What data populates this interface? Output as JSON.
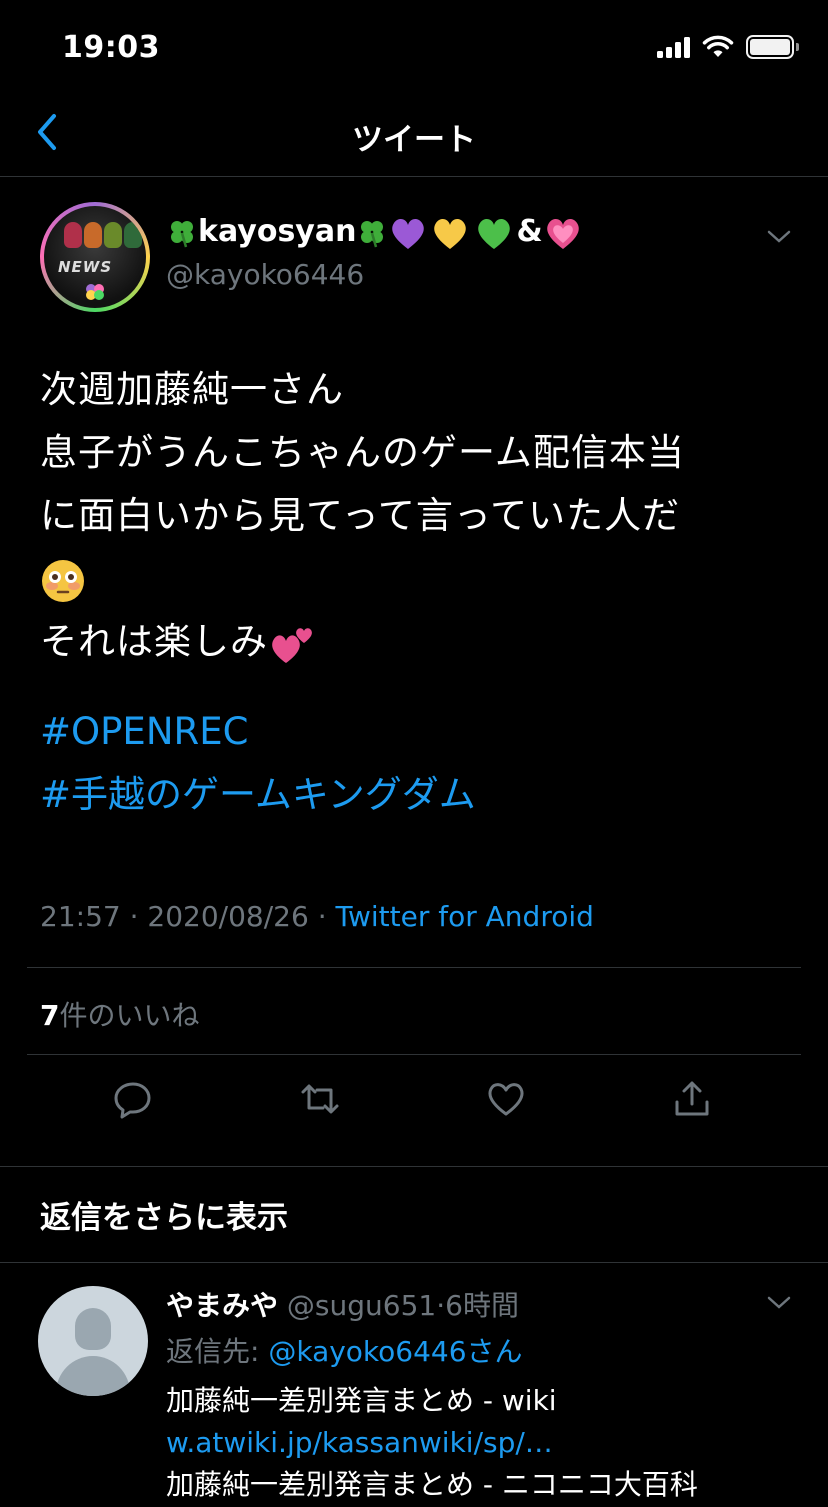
{
  "status_bar": {
    "time": "19:03"
  },
  "nav": {
    "title": "ツイート"
  },
  "tweet": {
    "display_name": "kayosyan",
    "name_suffix": "&",
    "handle": "@kayoko6446",
    "avatar_text": "NEWS",
    "body_lines": [
      "次週加藤純一さん",
      "息子がうんこちゃんのゲーム配信本当",
      "に面白いから見てって言っていた人だ",
      "",
      "それは楽しみ"
    ],
    "hashtags": [
      "#OPENREC",
      "#手越のゲームキングダム"
    ],
    "time": "21:57",
    "date": "2020/08/26",
    "separator": " · ",
    "source": "Twitter for Android",
    "likes_count": "7",
    "likes_label": "件のいいね",
    "colors": {
      "accent": "#1d9bf0",
      "muted": "#6e767d",
      "divider": "#2f3336"
    }
  },
  "more_replies": {
    "label": "返信をさらに表示"
  },
  "reply": {
    "name": "やまみや",
    "handle": "@sugu651",
    "dot": "·",
    "time": "6時間",
    "reply_to_prefix": "返信先: ",
    "reply_to_handle": "@kayoko6446さん",
    "line1": "加藤純一差別発言まとめ - wiki",
    "line2": "w.atwiki.jp/kassanwiki/sp/…",
    "line3": "加藤純一差別発言まとめ - ニコニコ大百科"
  }
}
